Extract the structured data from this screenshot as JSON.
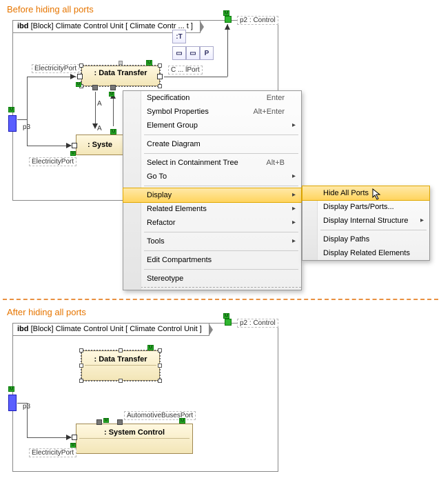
{
  "labels": {
    "before": "Before hiding all ports",
    "after": "After hiding all ports"
  },
  "frame": {
    "prefix": "ibd",
    "kind": "[Block]",
    "name": "Climate Control Unit",
    "view": "[ Climate Control Unit ]",
    "view_short": "[ Climate Contr ... t ]"
  },
  "blocks": {
    "data_transfer": ": Data Transfer",
    "system_control_short": ": Syste",
    "system_control": ": System Control"
  },
  "ports": {
    "p2": "p2 : Control",
    "p3": "p3",
    "electricity": "ElectricityPort",
    "control": "C ... lPort",
    "automotive": "AutomotiveBusesPort",
    "m": "M"
  },
  "toolbar": {
    "t": ":T",
    "box": "▭",
    "p": "P"
  },
  "ctx": {
    "specification": "Specification",
    "symbol_props": "Symbol Properties",
    "element_group": "Element Group",
    "create_diagram": "Create Diagram",
    "select_tree": "Select in Containment Tree",
    "go_to": "Go To",
    "display": "Display",
    "related_elements": "Related Elements",
    "refactor": "Refactor",
    "tools": "Tools",
    "edit_compartments": "Edit Compartments",
    "stereotype": "Stereotype",
    "shortcuts": {
      "enter": "Enter",
      "alt_enter": "Alt+Enter",
      "alt_b": "Alt+B"
    }
  },
  "submenu": {
    "hide_all_ports": "Hide All Ports",
    "display_parts_ports": "Display Parts/Ports...",
    "display_internal": "Display Internal Structure",
    "display_paths": "Display Paths",
    "display_related": "Display Related Elements"
  }
}
